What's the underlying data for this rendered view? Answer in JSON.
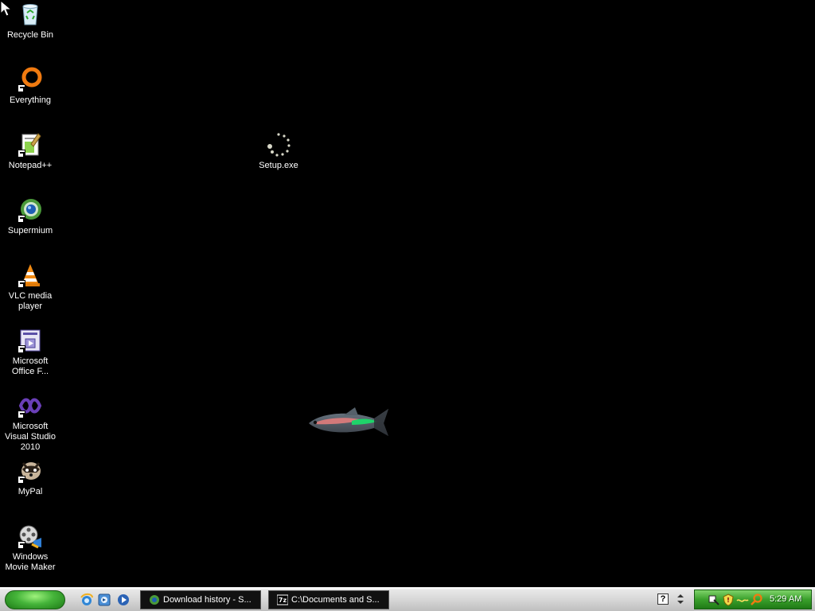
{
  "desktop": {
    "icons": [
      {
        "label": "Recycle Bin",
        "icon": "recycle-bin-icon"
      },
      {
        "label": "Everything",
        "icon": "everything-icon"
      },
      {
        "label": "Notepad++",
        "icon": "notepad-plus-plus-icon"
      },
      {
        "label": "Supermium",
        "icon": "supermium-icon"
      },
      {
        "label": "VLC media player",
        "icon": "vlc-icon"
      },
      {
        "label": "Microsoft Office F...",
        "icon": "office-icon"
      },
      {
        "label": "Microsoft Visual Studio 2010",
        "icon": "visual-studio-icon"
      },
      {
        "label": "MyPal",
        "icon": "mypal-icon"
      },
      {
        "label": "Windows Movie Maker",
        "icon": "movie-maker-icon"
      },
      {
        "label": "Setup.exe",
        "icon": "loading-spinner-icon"
      }
    ]
  },
  "taskbar": {
    "tasks": [
      {
        "label": "Download history - S..."
      },
      {
        "label": "C:\\Documents and S..."
      }
    ],
    "help_glyph": "?",
    "clock": "5:29 AM"
  },
  "colors": {
    "desktop_bg": "#000000",
    "taskbar_bg": "#d7d7d7",
    "start_green": "#45b43a",
    "tray_green": "#3aa02c"
  }
}
